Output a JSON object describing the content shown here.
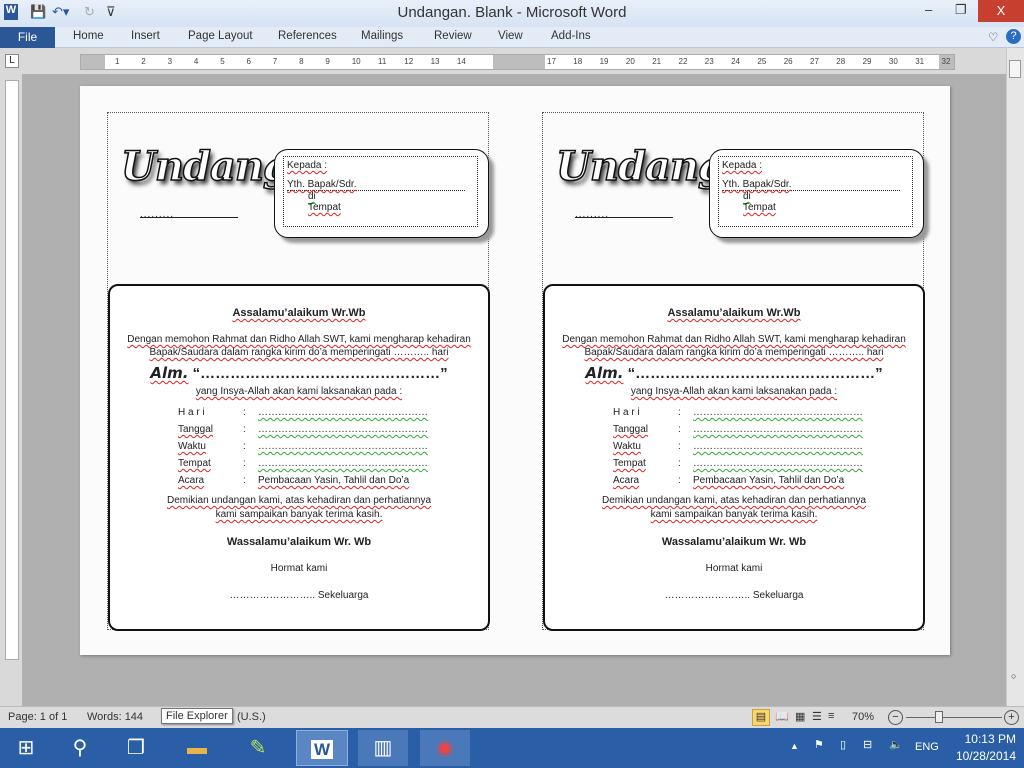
{
  "window": {
    "title": "Undangan. Blank - Microsoft Word",
    "close": "X",
    "minimize": "–",
    "restore": "❐"
  },
  "ribbon": {
    "file": "File",
    "tabs": [
      "Home",
      "Insert",
      "Page Layout",
      "References",
      "Mailings",
      "Review",
      "View",
      "Add-Ins"
    ],
    "help": "?"
  },
  "ruler": {
    "left_numbers": [
      "1",
      "2",
      "3",
      "4",
      "5",
      "6",
      "7",
      "8",
      "9",
      "10",
      "11",
      "12",
      "13",
      "14"
    ],
    "right_numbers": [
      "17",
      "18",
      "19",
      "20",
      "21",
      "22",
      "23",
      "24",
      "25",
      "26",
      "27",
      "28",
      "29",
      "30",
      "31",
      "32"
    ]
  },
  "card": {
    "logo": "Undangan",
    "date_line": "........, ......................",
    "kepada": "Kepada :",
    "yth": "Yth. Bapak/Sdr.",
    "di": "di",
    "tempat": "Tempat",
    "greeting": "Assalamu’alaikum Wr.Wb",
    "intro1": "Dengan memohon Rahmat dan Ridho Allah SWT, kami mengharap kehadiran",
    "intro2": "Bapak/Saudara dalam rangka kirim do’a memperingati ……….. hari",
    "alm": "Alm.",
    "alm_name": "“…………………………………………”",
    "insya": "yang Insya-Allah akan kami laksanakan pada :",
    "details": [
      {
        "label": "H a r i",
        "value": "……………………………………………"
      },
      {
        "label": "Tanggal",
        "value": "……………………………………………"
      },
      {
        "label": "Waktu",
        "value": "……………………………………………"
      },
      {
        "label": "Tempat",
        "value": "……………………………………………"
      },
      {
        "label": "Acara",
        "value": "Pembacaan Yasin, Tahlil dan Do’a"
      }
    ],
    "colon": ":",
    "closing1": "Demikian undangan kami, atas kehadiran dan perhatiannya",
    "closing2": "kami sampaikan banyak terima kasih.",
    "farewell": "Wassalamu’alaikum Wr. Wb",
    "hormat": "Hormat kami",
    "signature": "…………………….. Sekeluarga"
  },
  "status": {
    "page": "Page: 1 of 1",
    "words": "Words: 144",
    "tooltip": "File Explorer",
    "language": "(U.S.)",
    "zoom": "70%",
    "zoom_percent": 70
  },
  "taskbar": {
    "time": "10:13 PM",
    "date": "10/28/2014",
    "lang": "ENG"
  }
}
